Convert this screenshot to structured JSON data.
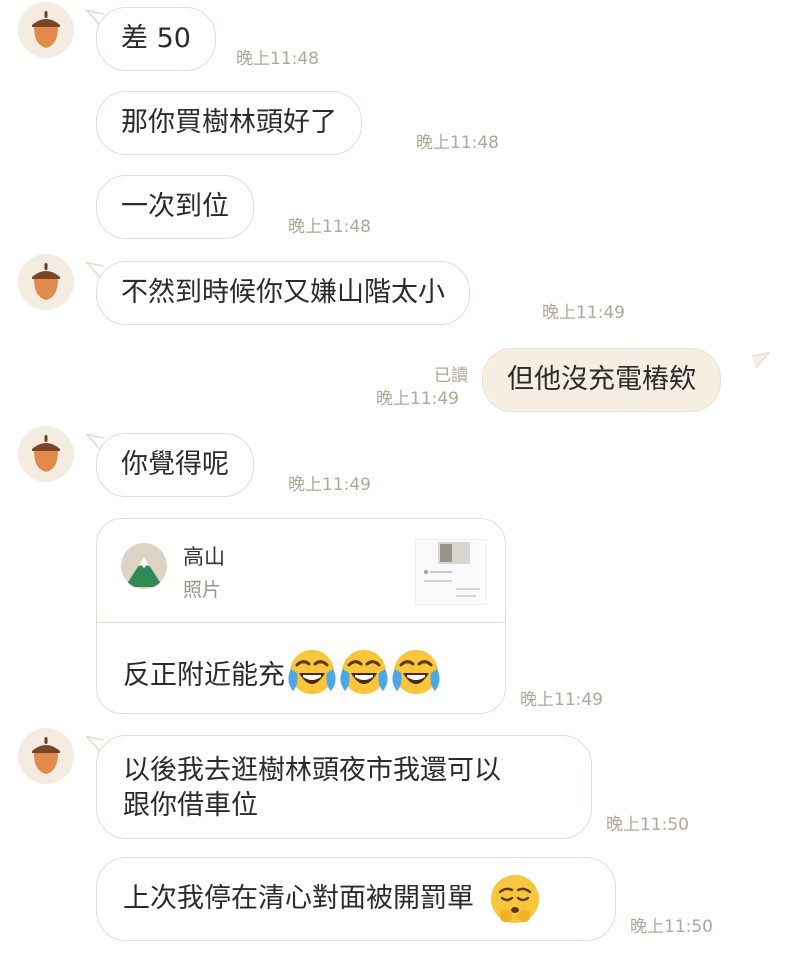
{
  "messages": [
    {
      "text": "差 50",
      "time": "晚上11:48"
    },
    {
      "text": "那你買樹林頭好了",
      "time": "晚上11:48"
    },
    {
      "text": "一次到位",
      "time": "晚上11:48"
    },
    {
      "text": "不然到時候你又嫌山階太小",
      "time": "晚上11:49"
    },
    {
      "text": "但他沒充電樁欸",
      "time": "晚上11:49",
      "read": "已讀"
    },
    {
      "text": "你覺得呢",
      "time": "晚上11:49"
    },
    {
      "quote_name": "高山",
      "quote_type": "照片",
      "text": "反正附近能充",
      "time": "晚上11:49"
    },
    {
      "line1": "以後我去逛樹林頭夜市我還可以",
      "line2": "跟你借車位",
      "time": "晚上11:50"
    },
    {
      "text": "上次我停在清心對面被開罰單",
      "time": "晚上11:50"
    }
  ],
  "icons": {
    "avatar": "acorn-icon",
    "quote": "mountain-icon",
    "laugh": "crying-laughing-emoji",
    "shy": "pleading-emoji"
  },
  "colors": {
    "incoming_bubble": "#ffffff",
    "outgoing_bubble": "#f6eee2",
    "border": "#e7ddcf",
    "timestamp": "#b0a796"
  }
}
